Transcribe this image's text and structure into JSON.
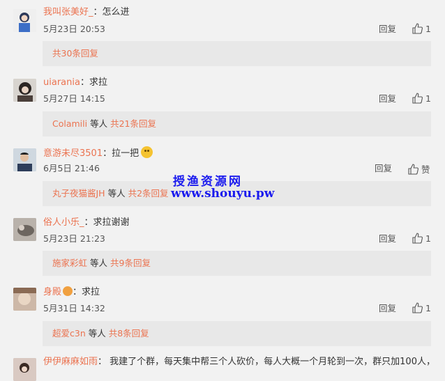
{
  "comments": [
    {
      "user": "我叫张美好_",
      "text": "怎么进",
      "time": "5月23日 20:53",
      "reply": "回复",
      "likes": "1",
      "sub": {
        "who": "",
        "extra": "",
        "more": "共30条回复"
      }
    },
    {
      "user": "uiarania",
      "text": "求拉",
      "time": "5月27日 14:15",
      "reply": "回复",
      "likes": "1",
      "sub": {
        "who": "Colamili",
        "extra": "等人",
        "more": "共21条回复"
      }
    },
    {
      "user": "意游未尽3501",
      "text": "拉一把",
      "time": "6月5日 21:46",
      "reply": "回复",
      "likes": "赞",
      "sub": {
        "who": "丸子夜猫酱JH",
        "extra": "等人",
        "more": "共2条回复"
      }
    },
    {
      "user": "俗人小乐_",
      "text": "求拉谢谢",
      "time": "5月23日 21:23",
      "reply": "回复",
      "likes": "1",
      "sub": {
        "who": "施家彩虹",
        "extra": "等人",
        "more": "共9条回复"
      }
    },
    {
      "user": "身殿",
      "text": "求拉",
      "time": "5月31日 14:32",
      "reply": "回复",
      "likes": "1",
      "sub": {
        "who": "超爱c3n",
        "extra": "等人",
        "more": "共8条回复"
      }
    },
    {
      "user": "伊伊麻麻如雨",
      "text": "我建了个群，每天集中帮三个人砍价，每人大概一个月轮到一次，群只加100人，"
    }
  ],
  "watermark": {
    "line1": "授渔资源网",
    "line2": "www.shouyu.pw"
  },
  "colors": {
    "username": "#eb7350",
    "background": "#f2f2f2",
    "subbox": "#e8e8e8",
    "watermark": "#1a1aee"
  }
}
